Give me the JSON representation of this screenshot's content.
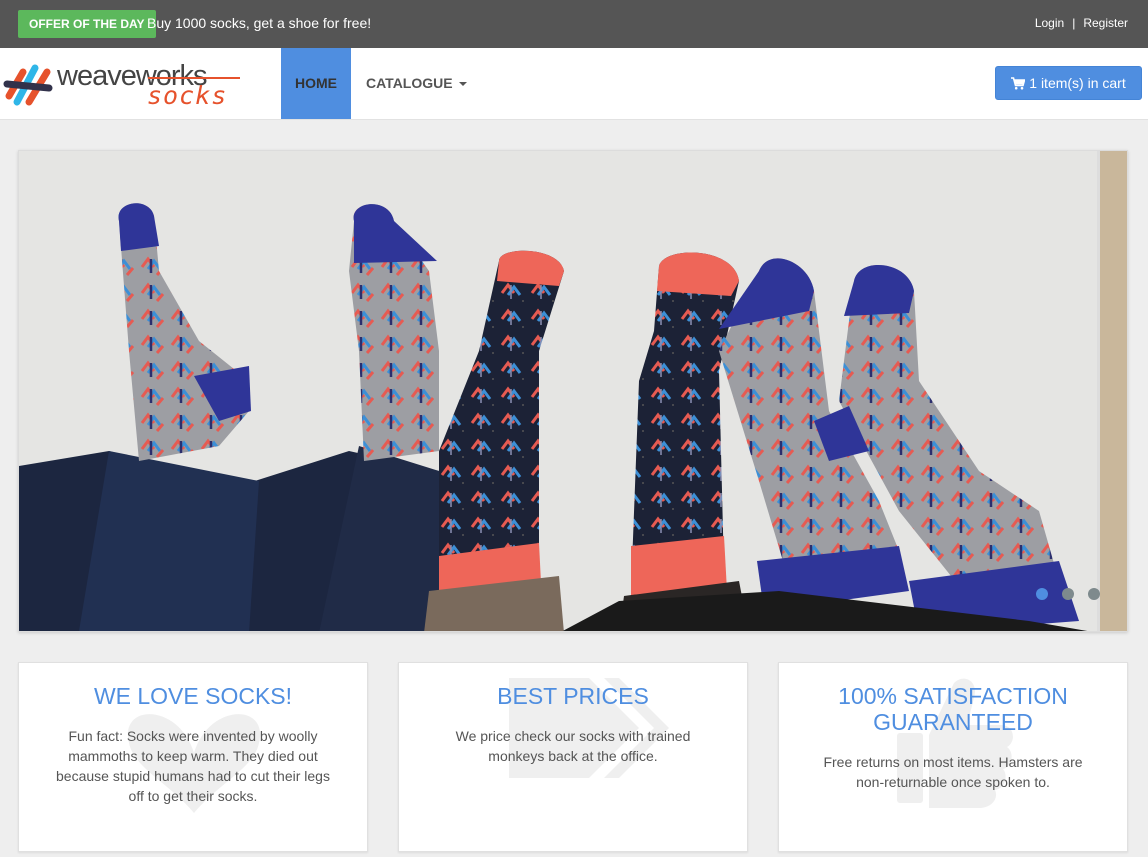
{
  "topbar": {
    "offer_badge": "OFFER OF THE DAY",
    "offer_text": "Buy 1000 socks, get a shoe for free!",
    "login": "Login",
    "separator": "|",
    "register": "Register"
  },
  "nav": {
    "logo_word": "weaveworks",
    "logo_socks": "socks",
    "home": "HOME",
    "catalogue": "CATALOGUE",
    "cart": "1 item(s) in cart"
  },
  "features": [
    {
      "title": "WE LOVE SOCKS!",
      "text": "Fun fact: Socks were invented by woolly mammoths to keep warm. They died out because stupid humans had to cut their legs off to get their socks.",
      "icon": "heart-icon"
    },
    {
      "title": "BEST PRICES",
      "text": "We price check our socks with trained monkeys back at the office.",
      "icon": "tags-icon"
    },
    {
      "title": "100% SATISFACTION GUARANTEED",
      "text": "Free returns on most items. Hamsters are non-returnable once spoken to.",
      "icon": "thumbs-up-icon"
    }
  ],
  "colors": {
    "accent": "#4f8ee0",
    "offer_green": "#5cb85c",
    "topbar": "#555555",
    "logo_orange": "#e6522c"
  }
}
